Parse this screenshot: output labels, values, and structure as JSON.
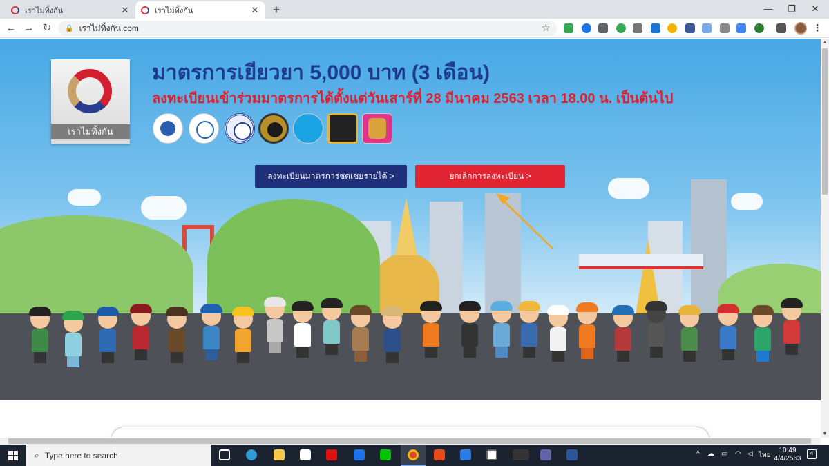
{
  "browser": {
    "tabs": [
      {
        "title": "เราไม่ทิ้งกัน",
        "active": false
      },
      {
        "title": "เราไม่ทิ้งกัน",
        "active": true
      }
    ],
    "new_tab_label": "+",
    "window_controls": {
      "minimize": "—",
      "maximize": "❐",
      "close": "✕"
    },
    "address": "เราไม่ทิ้งกัน.com"
  },
  "hero": {
    "logo_label": "เราไม่ทิ้งกัน",
    "title": "มาตรการเยียวยา 5,000 บาท (3 เดือน)",
    "subtitle": "ลงทะเบียนเข้าร่วมมาตรการได้ตั้งแต่วันเสาร์ที่ 28 มีนาคม 2563 เวลา 18.00 น. เป็นต้นไป",
    "agency_logos": [
      "finance-ministry-logo",
      "fiscal-policy-office-logo",
      "revenue-dept-logo",
      "excise-dept-logo",
      "krungthai-logo",
      "customs-dept-logo",
      "treasury-dept-logo"
    ],
    "register_button": "ลงทะเบียนมาตรการชดเชยรายได้ >",
    "cancel_button": "ยกเลิกการลงทะเบียน >"
  },
  "taskbar": {
    "search_placeholder": "Type here to search",
    "language": "ไทย",
    "time": "10:49",
    "date": "4/4/2563",
    "notification_count": "4"
  },
  "colors": {
    "title_blue": "#1e3c8c",
    "subtitle_red": "#e0202f",
    "register_btn": "#1f2f7a",
    "cancel_btn": "#e02431",
    "annotation_arrow": "#f5a623"
  }
}
